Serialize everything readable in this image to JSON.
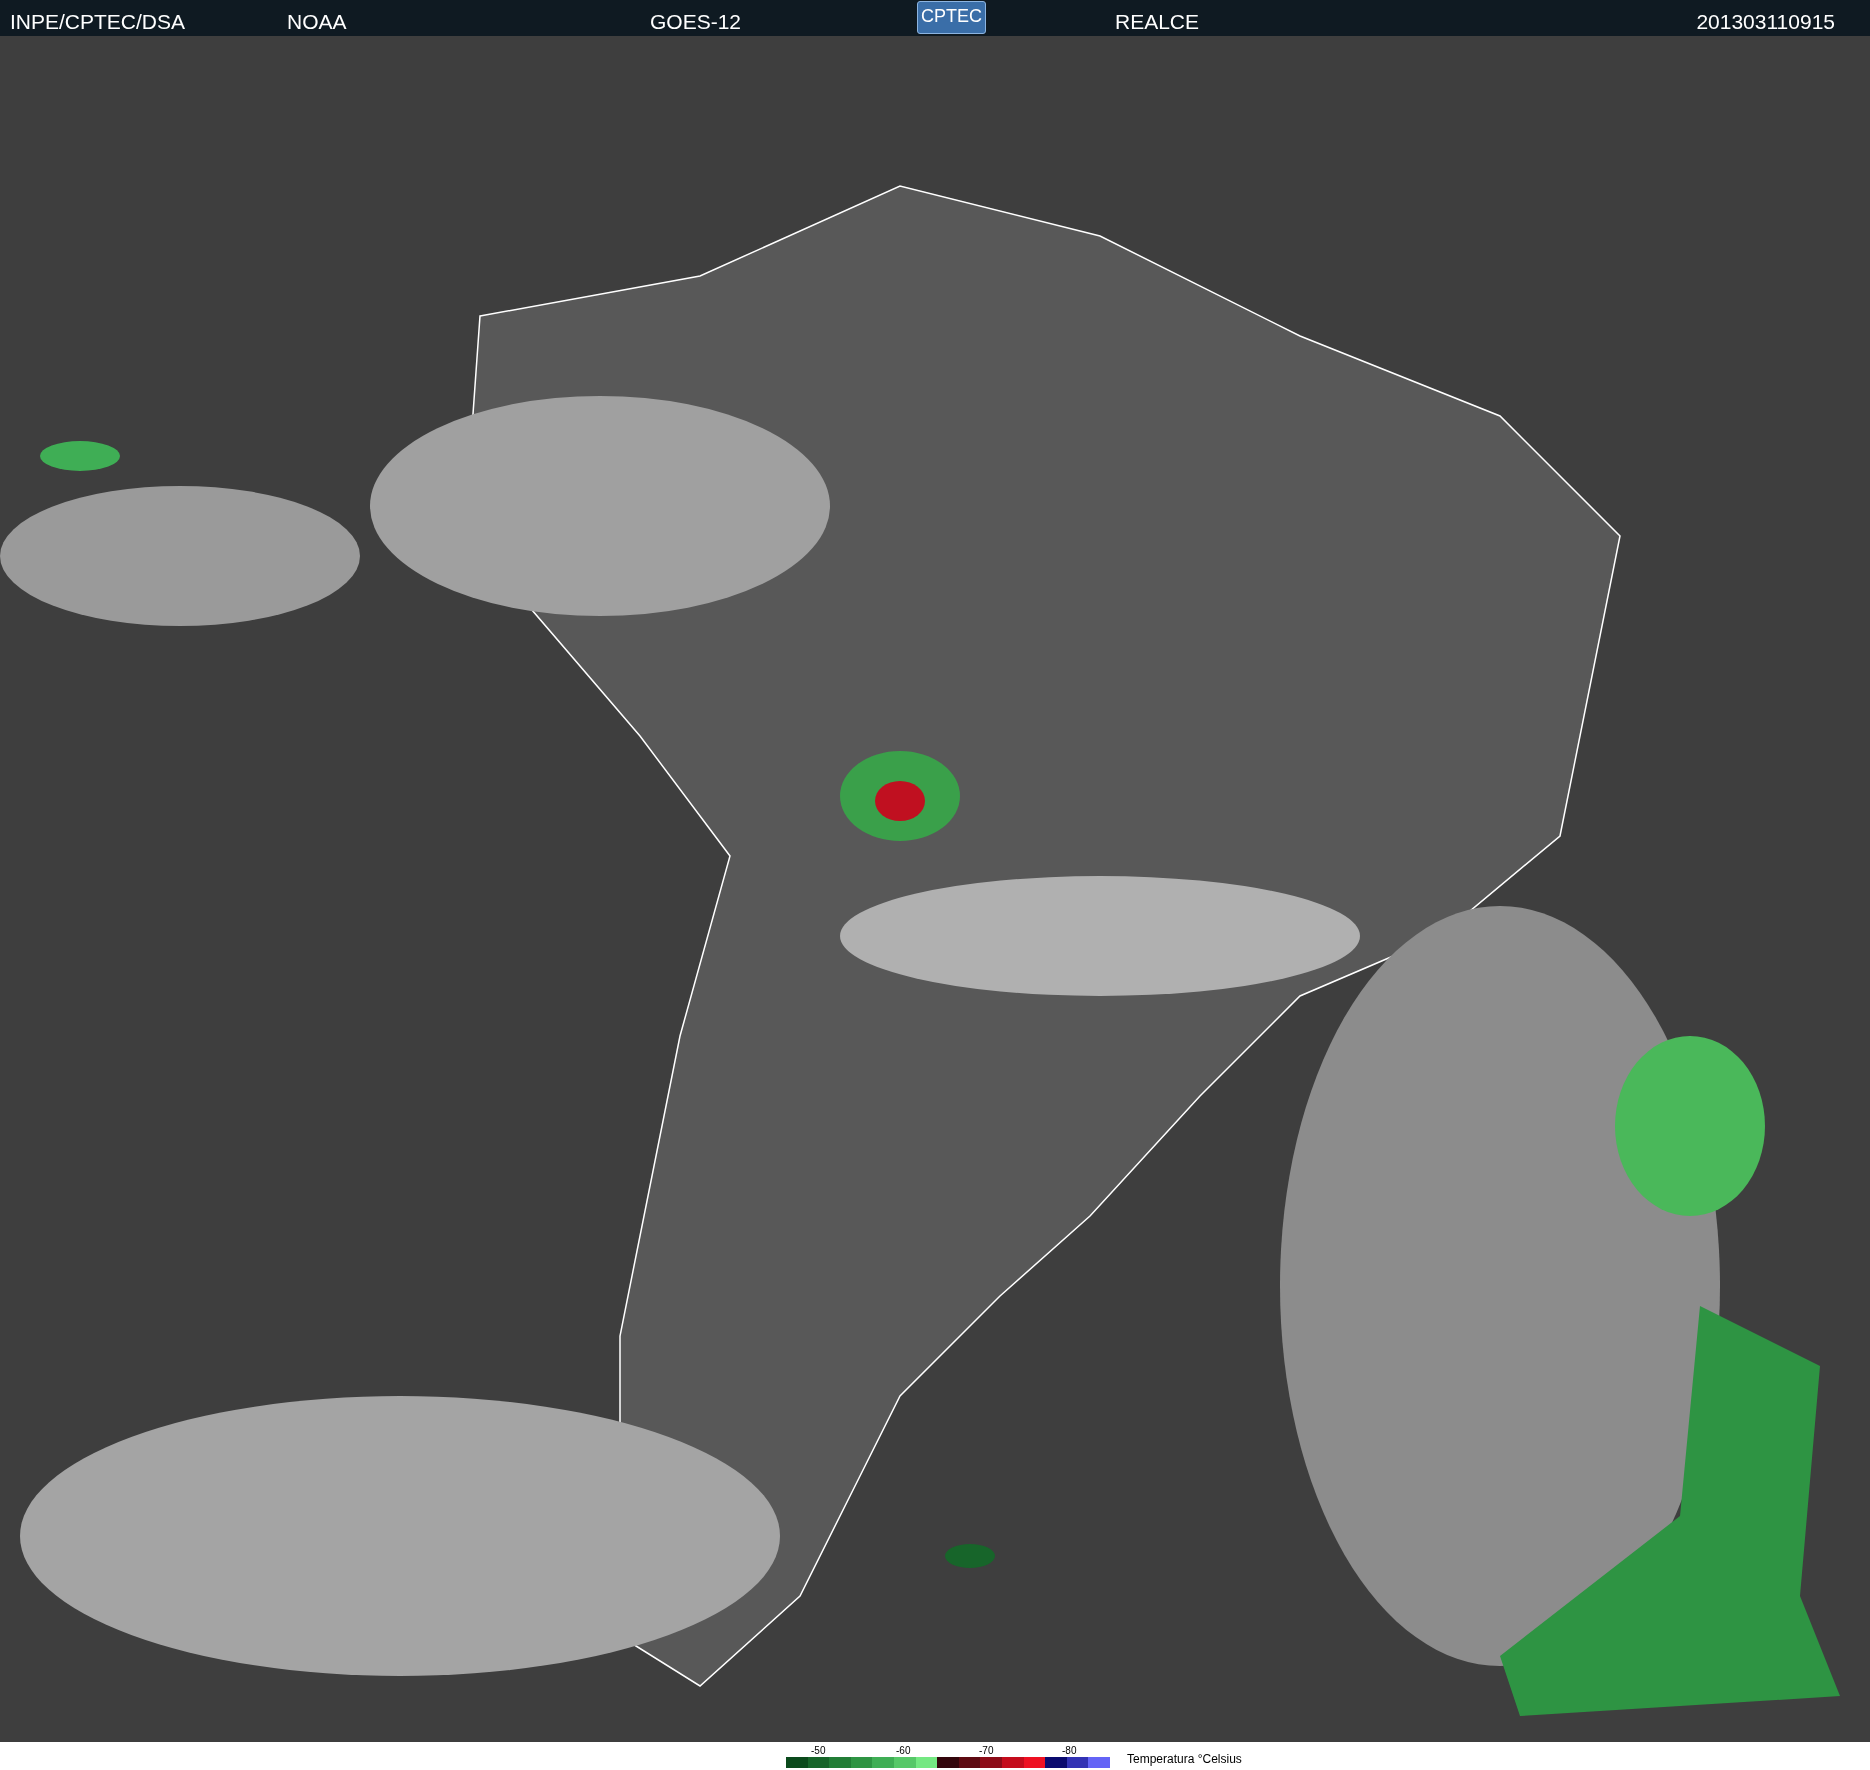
{
  "header": {
    "source": "INPE/CPTEC/DSA",
    "agency": "NOAA",
    "satellite": "GOES-12",
    "logo": "CPTEC",
    "product": "REALCE",
    "timestamp": "201303110915"
  },
  "legend": {
    "ticks": [
      "-50",
      "-60",
      "-70",
      "-80"
    ],
    "title": "Temperatura °Celsius",
    "swatches": [
      {
        "color": "#0b4a1c"
      },
      {
        "color": "#17652a"
      },
      {
        "color": "#227d36"
      },
      {
        "color": "#2e9443"
      },
      {
        "color": "#3fae55"
      },
      {
        "color": "#56c868"
      },
      {
        "color": "#74e882"
      },
      {
        "color": "#33060c"
      },
      {
        "color": "#5e0a12"
      },
      {
        "color": "#8c0c18"
      },
      {
        "color": "#c40c1c"
      },
      {
        "color": "#ee1022"
      },
      {
        "color": "#0a0a6e"
      },
      {
        "color": "#3232b4"
      },
      {
        "color": "#6464f6"
      }
    ]
  }
}
